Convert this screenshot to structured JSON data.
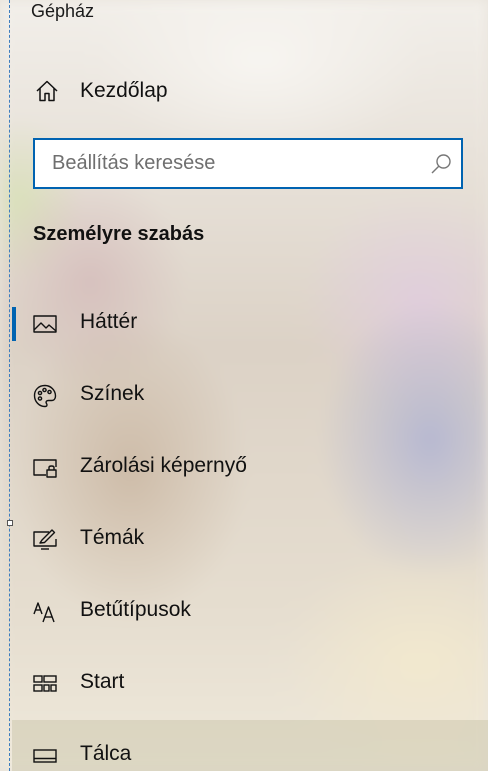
{
  "app": {
    "title": "Gépház"
  },
  "home": {
    "label": "Kezdőlap",
    "icon": "home-icon"
  },
  "search": {
    "placeholder": "Beállítás keresése",
    "value": "",
    "icon": "search-icon"
  },
  "section": {
    "title": "Személyre szabás"
  },
  "nav": {
    "items": [
      {
        "label": "Háttér",
        "icon": "picture-icon",
        "selected": true
      },
      {
        "label": "Színek",
        "icon": "palette-icon"
      },
      {
        "label": "Zárolási képernyő",
        "icon": "lock-screen-icon"
      },
      {
        "label": "Témák",
        "icon": "themes-icon"
      },
      {
        "label": "Betűtípusok",
        "icon": "fonts-icon"
      },
      {
        "label": "Start",
        "icon": "start-icon"
      },
      {
        "label": "Tálca",
        "icon": "taskbar-icon",
        "hover": true
      }
    ]
  },
  "colors": {
    "accent": "#0063b1",
    "text": "#111111"
  }
}
